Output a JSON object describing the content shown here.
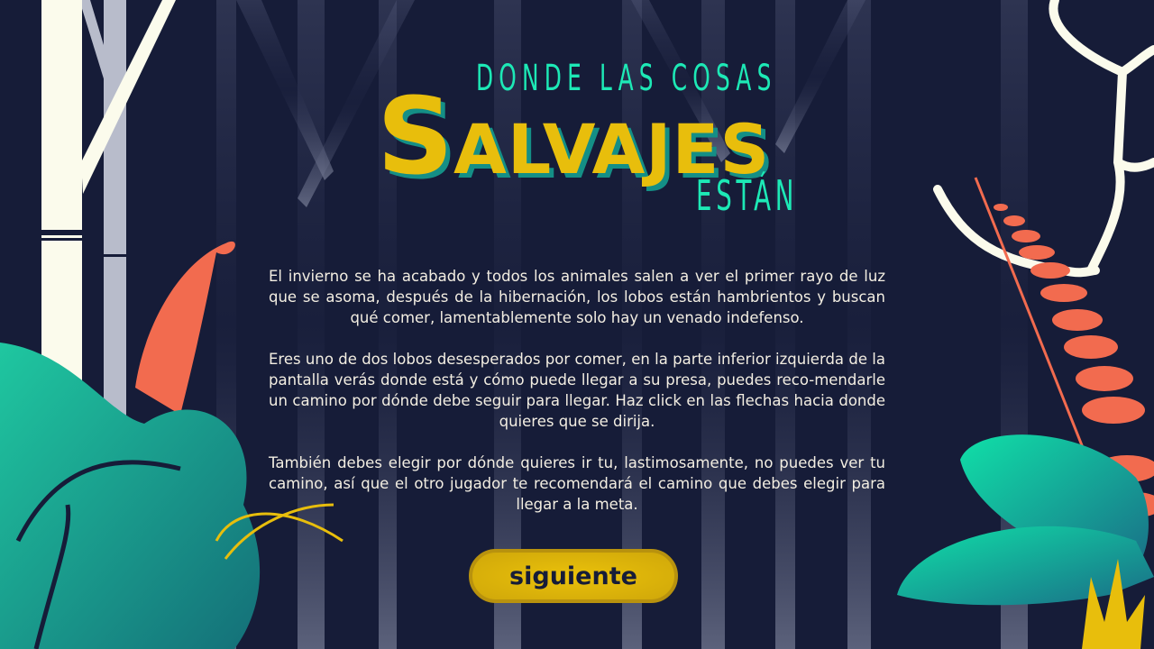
{
  "title": {
    "line1": "DONDE LAS COSAS",
    "main_initial": "S",
    "main_rest": "ALVAJES",
    "line3": "ESTÁN"
  },
  "intro": {
    "paragraphs": [
      "El invierno se ha acabado y todos los animales salen a ver el primer rayo de luz que se asoma, después de la hibernación, los lobos están hambrientos y buscan qué comer, lamentablemente solo hay un venado indefenso.",
      "Eres uno de dos lobos desesperados por comer, en la parte inferior izquierda de la pantalla verás donde está y cómo puede llegar a su presa, puedes reco-mendarle un camino por dónde debe seguir para llegar. Haz click en las flechas hacia donde quieres que se dirija.",
      "También debes elegir por dónde quieres ir tu, lastimosamente, no puedes ver tu camino, así que el otro jugador te recomendará el camino que debes elegir para llegar a la meta."
    ]
  },
  "buttons": {
    "next_label": "siguiente"
  },
  "colors": {
    "background": "#161c38",
    "title_yellow": "#e8be0c",
    "title_teal": "#1de9b6",
    "leaf_orange": "#f26b4f",
    "button": "#e0b80a"
  }
}
